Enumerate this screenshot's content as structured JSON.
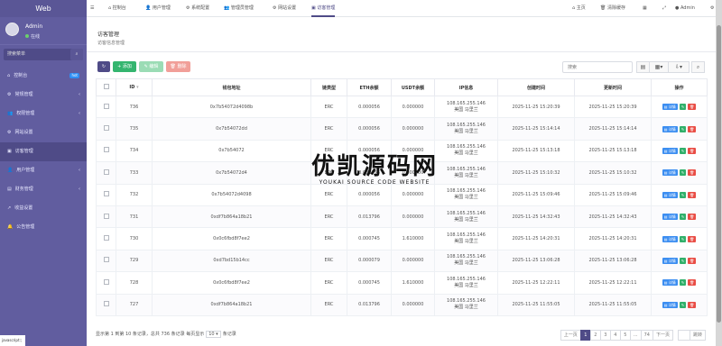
{
  "brand": {
    "title": "Web"
  },
  "user": {
    "name": "Admin",
    "status": "在线"
  },
  "sidebar": {
    "search_placeholder": "搜索菜单",
    "items": [
      {
        "label": "控制台",
        "badge": "hot"
      },
      {
        "label": "常规管理"
      },
      {
        "label": "权限管理"
      },
      {
        "label": "网站设置"
      },
      {
        "label": "访客管理"
      },
      {
        "label": "用户管理"
      },
      {
        "label": "财务管理"
      },
      {
        "label": "收益设置"
      },
      {
        "label": "公告管理"
      }
    ]
  },
  "top": {
    "tabs": [
      {
        "label": "控制台"
      },
      {
        "label": "用户管理"
      },
      {
        "label": "系统配置"
      },
      {
        "label": "管理员管理"
      },
      {
        "label": "网站设置"
      },
      {
        "label": "访客管理"
      }
    ],
    "home": "主页",
    "clear_cache": "清除缓存",
    "admin": "Admin"
  },
  "header": {
    "title": "访客管理",
    "subtitle": "访客信息管理"
  },
  "toolbar": {
    "add": "添加",
    "edit": "编辑",
    "delete": "删除",
    "search_placeholder": "搜索"
  },
  "table": {
    "headers": [
      "ID",
      "钱包地址",
      "链类型",
      "ETH余额",
      "USDT余额",
      "IP信息",
      "创建时间",
      "更新时间",
      "操作"
    ],
    "rows": [
      {
        "id": "736",
        "wallet": "0x7b54072d4098b",
        "chain": "ERC",
        "eth": "0.000056",
        "usdt": "0.000000",
        "ip": "108.165.255.146",
        "loc": "美国 马里兰",
        "created": "2025-11-25 15:20:39",
        "updated": "2025-11-25 15:20:39"
      },
      {
        "id": "735",
        "wallet": "0x7b54072dd",
        "chain": "ERC",
        "eth": "0.000056",
        "usdt": "0.000000",
        "ip": "108.165.255.146",
        "loc": "美国 马里兰",
        "created": "2025-11-25 15:14:14",
        "updated": "2025-11-25 15:14:14"
      },
      {
        "id": "734",
        "wallet": "0x7b54072",
        "chain": "ERC",
        "eth": "0.000056",
        "usdt": "0.000000",
        "ip": "108.165.255.146",
        "loc": "美国 马里兰",
        "created": "2025-11-25 15:13:18",
        "updated": "2025-11-25 15:13:18"
      },
      {
        "id": "733",
        "wallet": "0x7b54072d4",
        "chain": "ERC",
        "eth": "0.000056",
        "usdt": "0.000000",
        "ip": "108.165.255.146",
        "loc": "美国 马里兰",
        "created": "2025-11-25 15:10:32",
        "updated": "2025-11-25 15:10:32"
      },
      {
        "id": "732",
        "wallet": "0x7b54072d4098",
        "chain": "ERC",
        "eth": "0.000056",
        "usdt": "0.000000",
        "ip": "108.165.255.146",
        "loc": "美国 马里兰",
        "created": "2025-11-25 15:09:46",
        "updated": "2025-11-25 15:09:46"
      },
      {
        "id": "731",
        "wallet": "0xdf7b864a18b21",
        "chain": "ERC",
        "eth": "0.013796",
        "usdt": "0.000000",
        "ip": "108.165.255.146",
        "loc": "美国 马里兰",
        "created": "2025-11-25 14:32:43",
        "updated": "2025-11-25 14:32:43"
      },
      {
        "id": "730",
        "wallet": "0x0c6fbd8f7ee2",
        "chain": "ERC",
        "eth": "0.000745",
        "usdt": "1.610000",
        "ip": "108.165.255.146",
        "loc": "美国 马里兰",
        "created": "2025-11-25 14:20:31",
        "updated": "2025-11-25 14:20:31"
      },
      {
        "id": "729",
        "wallet": "0xd7bd15b14cc",
        "chain": "ERC",
        "eth": "0.000079",
        "usdt": "0.000000",
        "ip": "108.165.255.146",
        "loc": "美国 马里兰",
        "created": "2025-11-25 13:06:28",
        "updated": "2025-11-25 13:06:28"
      },
      {
        "id": "728",
        "wallet": "0x0c6fbd8f7ee2",
        "chain": "ERC",
        "eth": "0.000745",
        "usdt": "1.610000",
        "ip": "108.165.255.146",
        "loc": "美国 马里兰",
        "created": "2025-11-25 12:22:11",
        "updated": "2025-11-25 12:22:11"
      },
      {
        "id": "727",
        "wallet": "0xdf7b864a18b21",
        "chain": "ERC",
        "eth": "0.013796",
        "usdt": "0.000000",
        "ip": "108.165.255.146",
        "loc": "美国 马里兰",
        "created": "2025-11-25 11:55:05",
        "updated": "2025-11-25 11:55:05"
      }
    ]
  },
  "actions": {
    "detail": "详情"
  },
  "footer": {
    "summary": "显示第 1 到第 10 条记录，总共 736 条记录 每页显示",
    "per_page": "10",
    "records": "条记录"
  },
  "pagination": {
    "prev": "上一页",
    "pages": [
      "1",
      "2",
      "3",
      "4",
      "5",
      "...",
      "74"
    ],
    "next": "下一页",
    "jump": "跳转"
  },
  "watermark": {
    "title": "优凯源码网",
    "subtitle": "YOUKAI SOURCE CODE WEBSITE"
  },
  "status": {
    "bottom_left": "javascript:;"
  }
}
